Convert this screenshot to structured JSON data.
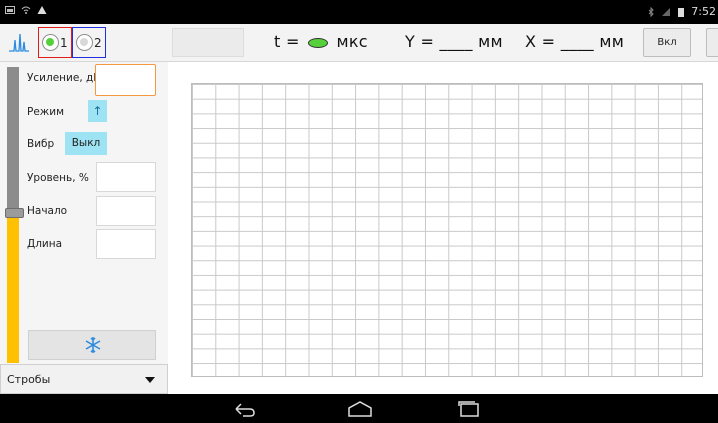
{
  "status_bar": {
    "time": "7:52",
    "left_icons": [
      "image-icon",
      "wifi-icon",
      "warning-icon"
    ],
    "right_icons": [
      "bluetooth-icon",
      "signal-icon",
      "battery-icon"
    ]
  },
  "toolbar": {
    "channel1_label": "1",
    "channel2_label": "2",
    "t_label": "t =",
    "t_unit": "мкс",
    "y_label": "Y = ____",
    "y_unit": "мм",
    "x_label": "X = ____",
    "x_unit": "мм",
    "power_button": "Вкл"
  },
  "panel": {
    "gain_label": "Усиление, дБ",
    "mode_label": "Режим",
    "mode_value": "↑",
    "vibr_label": "Вибр",
    "vibr_value": "Выкл",
    "level_label": "Уровень, %",
    "start_label": "Начало",
    "length_label": "Длина",
    "freeze_icon": "snowflake-icon",
    "dropdown_value": "Стробы",
    "slider_level": 0.5
  },
  "colors": {
    "slider_fill": "#ffc000",
    "indicator_green": "#54d13a",
    "channel1_border": "#e21b1b",
    "channel2_border": "#2030e0",
    "accent_blue": "#9ee3f3",
    "focus_orange": "#f29a3d"
  },
  "nav_bar": {
    "icons": [
      "back-icon",
      "home-icon",
      "recent-apps-icon"
    ]
  }
}
